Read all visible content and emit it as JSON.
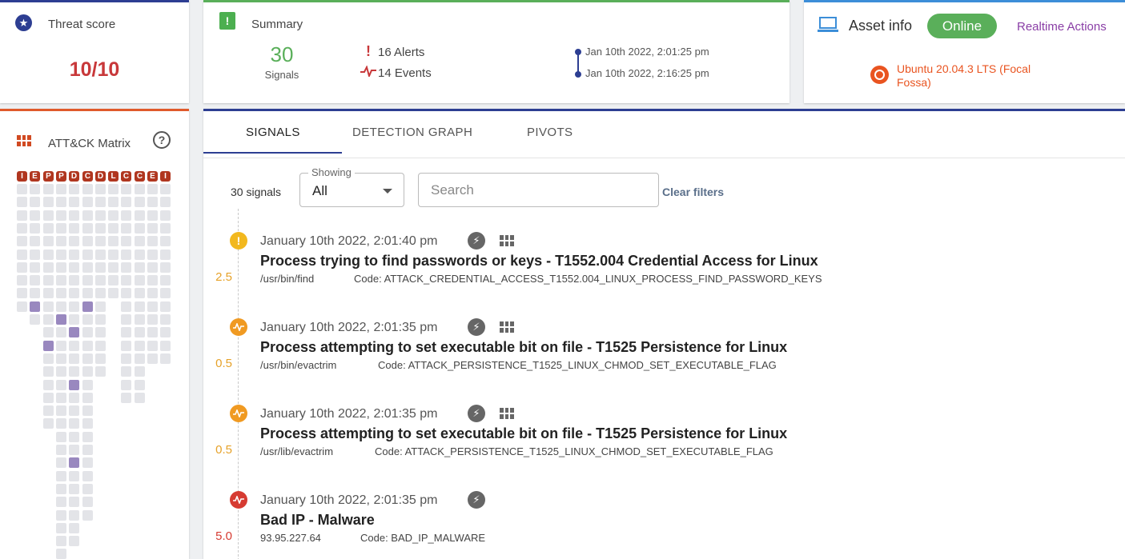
{
  "threat": {
    "title": "Threat score",
    "score": "10/10"
  },
  "summary": {
    "title": "Summary",
    "signals_count": "30",
    "signals_label": "Signals",
    "alerts": "16 Alerts",
    "events": "14 Events",
    "time_start": "Jan 10th 2022, 2:01:25 pm",
    "time_end": "Jan 10th 2022, 2:16:25 pm"
  },
  "asset": {
    "title": "Asset info",
    "status": "Online",
    "realtime_actions": "Realtime Actions",
    "os": "Ubuntu 20.04.3 LTS (Focal Fossa)"
  },
  "matrix": {
    "title": "ATT&CK Matrix",
    "help": "?",
    "headers": [
      "I",
      "E",
      "P",
      "P",
      "D",
      "C",
      "D",
      "L",
      "C",
      "C",
      "E",
      "I"
    ],
    "column_counts": [
      10,
      11,
      19,
      30,
      28,
      26,
      15,
      9,
      17,
      17,
      14,
      14
    ],
    "highlighted": [
      [
        1,
        9
      ],
      [
        3,
        10
      ],
      [
        2,
        12
      ],
      [
        4,
        11
      ],
      [
        5,
        9
      ],
      [
        4,
        15
      ],
      [
        6,
        16
      ],
      [
        4,
        21
      ],
      [
        6,
        23
      ]
    ]
  },
  "tabs": [
    {
      "label": "SIGNALS",
      "active": true
    },
    {
      "label": "DETECTION GRAPH",
      "active": false
    },
    {
      "label": "PIVOTS",
      "active": false
    }
  ],
  "filters": {
    "count": "30 signals",
    "showing_label": "Showing",
    "showing_value": "All",
    "search_placeholder": "Search",
    "clear": "Clear filters"
  },
  "signals": [
    {
      "type": "alert",
      "color": "#f2b81e",
      "score": "2.5",
      "score_color": "#e6a22a",
      "time": "January 10th 2022, 2:01:40 pm",
      "name": "Process trying to find passwords or keys - T1552.004 Credential Access for Linux",
      "path": "/usr/bin/find",
      "code": "Code: ATTACK_CREDENTIAL_ACCESS_T1552.004_LINUX_PROCESS_FIND_PASSWORD_KEYS",
      "has_matrix_icon": true
    },
    {
      "type": "event",
      "color": "#f09a22",
      "score": "0.5",
      "score_color": "#e6a22a",
      "time": "January 10th 2022, 2:01:35 pm",
      "name": "Process attempting to set executable bit on file - T1525 Persistence for Linux",
      "path": "/usr/bin/evactrim",
      "code": "Code: ATTACK_PERSISTENCE_T1525_LINUX_CHMOD_SET_EXECUTABLE_FLAG",
      "has_matrix_icon": true
    },
    {
      "type": "event",
      "color": "#f09a22",
      "score": "0.5",
      "score_color": "#e6a22a",
      "time": "January 10th 2022, 2:01:35 pm",
      "name": "Process attempting to set executable bit on file - T1525 Persistence for Linux",
      "path": "/usr/lib/evactrim",
      "code": "Code: ATTACK_PERSISTENCE_T1525_LINUX_CHMOD_SET_EXECUTABLE_FLAG",
      "has_matrix_icon": true
    },
    {
      "type": "event",
      "color": "#d63b32",
      "score": "5.0",
      "score_color": "#d63b32",
      "time": "January 10th 2022, 2:01:35 pm",
      "name": "Bad IP - Malware",
      "path": "93.95.227.64",
      "code": "Code: BAD_IP_MALWARE",
      "has_matrix_icon": false
    }
  ]
}
